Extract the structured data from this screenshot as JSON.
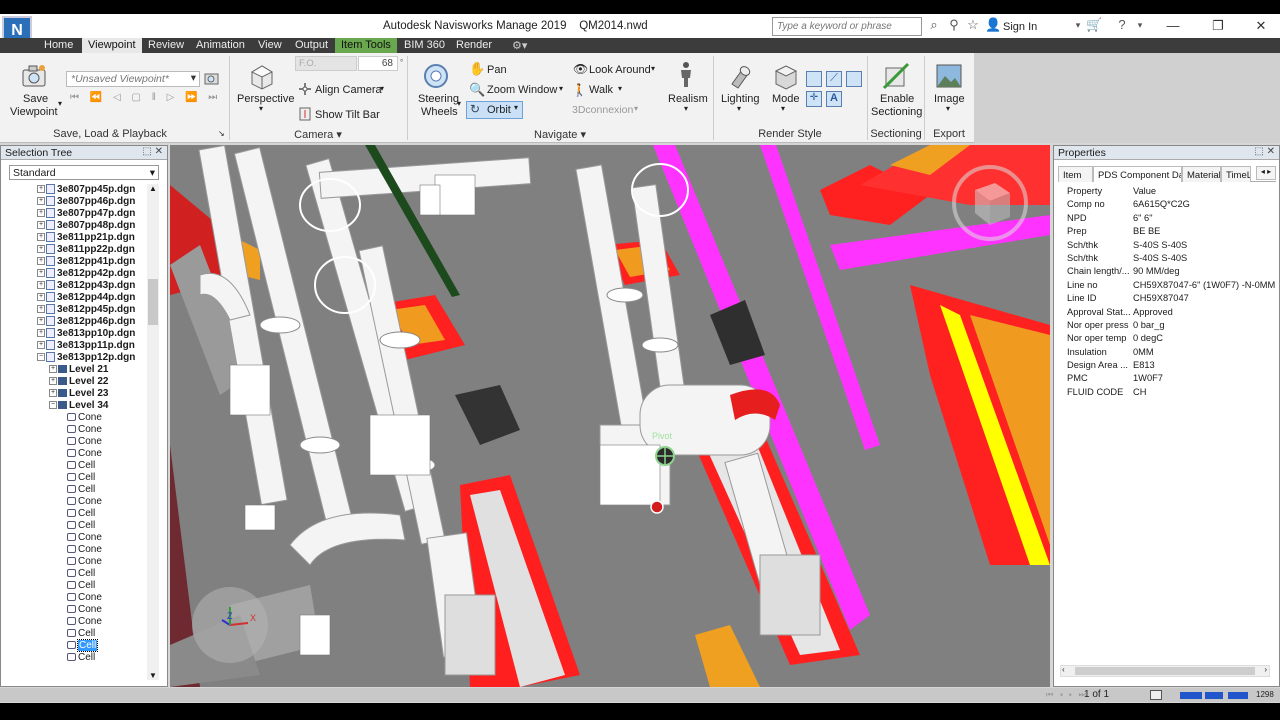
{
  "app": {
    "logo": "N",
    "title": "Autodesk Navisworks Manage 2019    QM2014.nwd",
    "search_placeholder": "Type a keyword or phrase",
    "sign_in": "Sign In"
  },
  "tabs": [
    "Home",
    "Viewpoint",
    "Review",
    "Animation",
    "View",
    "Output",
    "Item Tools",
    "BIM 360",
    "Render"
  ],
  "active_tab": "Viewpoint",
  "ribbon": {
    "save_viewpoint_line1": "Save",
    "save_viewpoint_line2": "Viewpoint",
    "viewpoint_dropdown": "*Unsaved Viewpoint*",
    "panel_save": "Save, Load & Playback",
    "perspective": "Perspective",
    "fov_label": "F.O.",
    "fov_value": "68",
    "align_camera": "Align Camera",
    "show_tilt_bar": "Show Tilt Bar",
    "panel_camera": "Camera",
    "steering_line1": "Steering",
    "steering_line2": "Wheels",
    "pan": "Pan",
    "zoom_window": "Zoom Window",
    "orbit": "Orbit",
    "look_around": "Look Around",
    "walk": "Walk",
    "connexion": "3Dconnexion",
    "realism": "Realism",
    "panel_navigate": "Navigate",
    "lighting": "Lighting",
    "mode": "Mode",
    "panel_render": "Render Style",
    "enable_line1": "Enable",
    "enable_line2": "Sectioning",
    "panel_sectioning": "Sectioning",
    "image": "Image",
    "panel_export": "Export"
  },
  "selection_tree": {
    "title": "Selection Tree",
    "mode": "Standard",
    "files": [
      "3e807pp45p.dgn",
      "3e807pp46p.dgn",
      "3e807pp47p.dgn",
      "3e807pp48p.dgn",
      "3e811pp21p.dgn",
      "3e811pp22p.dgn",
      "3e812pp41p.dgn",
      "3e812pp42p.dgn",
      "3e812pp43p.dgn",
      "3e812pp44p.dgn",
      "3e812pp45p.dgn",
      "3e812pp46p.dgn",
      "3e813pp10p.dgn",
      "3e813pp11p.dgn",
      "3e813pp12p.dgn"
    ],
    "levels": [
      "Level 21",
      "Level 22",
      "Level 23",
      "Level 34"
    ],
    "geometry": [
      "Cone",
      "Cone",
      "Cone",
      "Cone",
      "Cell",
      "Cell",
      "Cell",
      "Cone",
      "Cell",
      "Cell",
      "Cone",
      "Cone",
      "Cone",
      "Cell",
      "Cell",
      "Cone",
      "Cone",
      "Cone",
      "Cell",
      "Cell",
      "Cell"
    ],
    "selected_index": 19
  },
  "viewport": {
    "pivot_label": "Pivot",
    "gizmo_x": "X",
    "gizmo_z": "Z"
  },
  "properties": {
    "title": "Properties",
    "tabs": [
      "Item",
      "PDS Component Data",
      "Material",
      "TimeL"
    ],
    "active_tab": "PDS Component Data",
    "header_key": "Property",
    "header_value": "Value",
    "rows": [
      {
        "k": "Comp no",
        "v": "6A615Q*C2G"
      },
      {
        "k": "NPD",
        "v": "6\" 6\""
      },
      {
        "k": "Prep",
        "v": "BE BE"
      },
      {
        "k": "Sch/thk",
        "v": "S-40S S-40S"
      },
      {
        "k": "Sch/thk",
        "v": "S-40S S-40S"
      },
      {
        "k": "Chain length/...",
        "v": "90 MM/deg"
      },
      {
        "k": "Line no",
        "v": "CH59X87047-6\" (1W0F7) -N-0MM"
      },
      {
        "k": "Line ID",
        "v": "CH59X87047"
      },
      {
        "k": "Approval Stat...",
        "v": "Approved"
      },
      {
        "k": "Nor oper press",
        "v": "0 bar_g"
      },
      {
        "k": "Nor oper temp",
        "v": "0 degC"
      },
      {
        "k": "Insulation",
        "v": "0MM"
      },
      {
        "k": "Design Area ...",
        "v": "E813"
      },
      {
        "k": "PMC",
        "v": "1W0F7"
      },
      {
        "k": "FLUID CODE",
        "v": "CH"
      }
    ]
  },
  "status": {
    "page": "1 of 1",
    "memory": "1298"
  }
}
